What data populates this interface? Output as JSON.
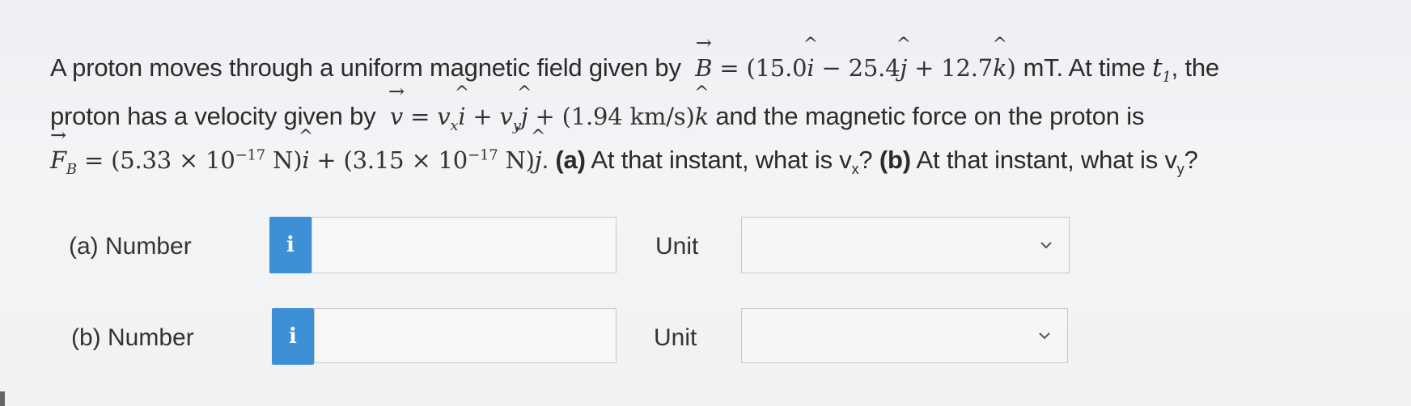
{
  "question": {
    "line1": {
      "text_a": "A proton moves through a uniform magnetic field given by",
      "B_symbol": "B",
      "B_expr": "= (15.0",
      "i1": "i",
      "B_expr2": " − 25.4",
      "j1": "j",
      "B_expr3": " + 12.7",
      "k1": "k",
      "B_expr4": ") ",
      "unit_mT": "mT. At time ",
      "t_sym": "t",
      "t_sub": "1",
      "text_b": ", the"
    },
    "line2": {
      "text_a": "proton has a velocity given by",
      "v_symbol": "v",
      "eq": " = ",
      "vx": "v",
      "vx_sub": "x",
      "i2": "i",
      "plus1": " + ",
      "vy": "v",
      "vy_sub": "y",
      "j2": "j",
      "plus2": " + (1.94 km/s)",
      "k2": "k",
      "text_b": " and the magnetic force on the proton is"
    },
    "line3": {
      "F_symbol": "F",
      "F_sub": "B",
      "expr1": " = (5.33 × 10",
      "exp1": "−17",
      "expr2": " N)",
      "i3": "i",
      "expr3": " + (3.15 × 10",
      "exp2": "−17",
      "expr4": " N)",
      "j3": "j",
      "dot": ". ",
      "part_a_bold": "(a)",
      "part_a_text": " At that instant, what is v",
      "part_a_sub": "x",
      "part_a_end": "? ",
      "part_b_bold": "(b)",
      "part_b_text": " At that instant, what is v",
      "part_b_sub": "y",
      "part_b_end": "?"
    }
  },
  "answers": [
    {
      "label": "(a)  Number",
      "info_icon": "i",
      "number_value": "",
      "unit_label": "Unit",
      "unit_selected": ""
    },
    {
      "label": "(b)  Number",
      "info_icon": "i",
      "number_value": "",
      "unit_label": "Unit",
      "unit_selected": ""
    }
  ],
  "colors": {
    "info_button": "#3d8fd6",
    "background": "#eef0f2"
  }
}
